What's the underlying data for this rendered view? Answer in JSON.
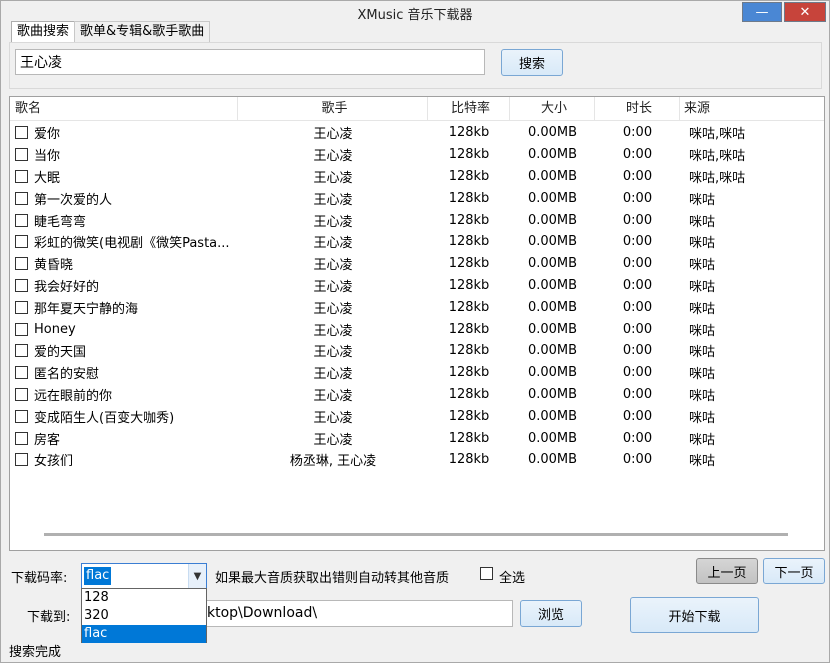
{
  "window": {
    "title": "XMusic 音乐下载器"
  },
  "tabs": [
    {
      "label": "歌曲搜索"
    },
    {
      "label": "歌单&专辑&歌手歌曲"
    }
  ],
  "search": {
    "value": "王心凌",
    "button": "搜索"
  },
  "columns": [
    "歌名",
    "歌手",
    "比特率",
    "大小",
    "时长",
    "来源"
  ],
  "rows": [
    {
      "name": "爱你",
      "singer": "王心凌",
      "bitrate": "128kb",
      "size": "0.00MB",
      "duration": "0:00",
      "source": "咪咕,咪咕"
    },
    {
      "name": "当你",
      "singer": "王心凌",
      "bitrate": "128kb",
      "size": "0.00MB",
      "duration": "0:00",
      "source": "咪咕,咪咕"
    },
    {
      "name": "大眠",
      "singer": "王心凌",
      "bitrate": "128kb",
      "size": "0.00MB",
      "duration": "0:00",
      "source": "咪咕,咪咕"
    },
    {
      "name": "第一次爱的人",
      "singer": "王心凌",
      "bitrate": "128kb",
      "size": "0.00MB",
      "duration": "0:00",
      "source": "咪咕"
    },
    {
      "name": "睫毛弯弯",
      "singer": "王心凌",
      "bitrate": "128kb",
      "size": "0.00MB",
      "duration": "0:00",
      "source": "咪咕"
    },
    {
      "name": "彩虹的微笑(电视剧《微笑Pasta...",
      "singer": "王心凌",
      "bitrate": "128kb",
      "size": "0.00MB",
      "duration": "0:00",
      "source": "咪咕"
    },
    {
      "name": "黄昏晓",
      "singer": "王心凌",
      "bitrate": "128kb",
      "size": "0.00MB",
      "duration": "0:00",
      "source": "咪咕"
    },
    {
      "name": "我会好好的",
      "singer": "王心凌",
      "bitrate": "128kb",
      "size": "0.00MB",
      "duration": "0:00",
      "source": "咪咕"
    },
    {
      "name": "那年夏天宁静的海",
      "singer": "王心凌",
      "bitrate": "128kb",
      "size": "0.00MB",
      "duration": "0:00",
      "source": "咪咕"
    },
    {
      "name": "Honey",
      "singer": "王心凌",
      "bitrate": "128kb",
      "size": "0.00MB",
      "duration": "0:00",
      "source": "咪咕"
    },
    {
      "name": "爱的天国",
      "singer": "王心凌",
      "bitrate": "128kb",
      "size": "0.00MB",
      "duration": "0:00",
      "source": "咪咕"
    },
    {
      "name": "匿名的安慰",
      "singer": "王心凌",
      "bitrate": "128kb",
      "size": "0.00MB",
      "duration": "0:00",
      "source": "咪咕"
    },
    {
      "name": "远在眼前的你",
      "singer": "王心凌",
      "bitrate": "128kb",
      "size": "0.00MB",
      "duration": "0:00",
      "source": "咪咕"
    },
    {
      "name": "变成陌生人(百变大咖秀)",
      "singer": "王心凌",
      "bitrate": "128kb",
      "size": "0.00MB",
      "duration": "0:00",
      "source": "咪咕"
    },
    {
      "name": "房客",
      "singer": "王心凌",
      "bitrate": "128kb",
      "size": "0.00MB",
      "duration": "0:00",
      "source": "咪咕"
    },
    {
      "name": "女孩们",
      "singer": "杨丞琳, 王心凌",
      "bitrate": "128kb",
      "size": "0.00MB",
      "duration": "0:00",
      "source": "咪咕"
    }
  ],
  "bottom": {
    "bitrate_label": "下载码率:",
    "bitrate_value": "flac",
    "bitrate_options": [
      "128",
      "320",
      "flac"
    ],
    "fallback_note": "如果最大音质获取出错则自动转其他音质",
    "select_all": "全选",
    "prev_page": "上一页",
    "next_page": "下一页",
    "save_label": "下载到:",
    "save_path": "ktop\\Download\\",
    "browse": "浏览",
    "start": "开始下载"
  },
  "status": "搜索完成"
}
